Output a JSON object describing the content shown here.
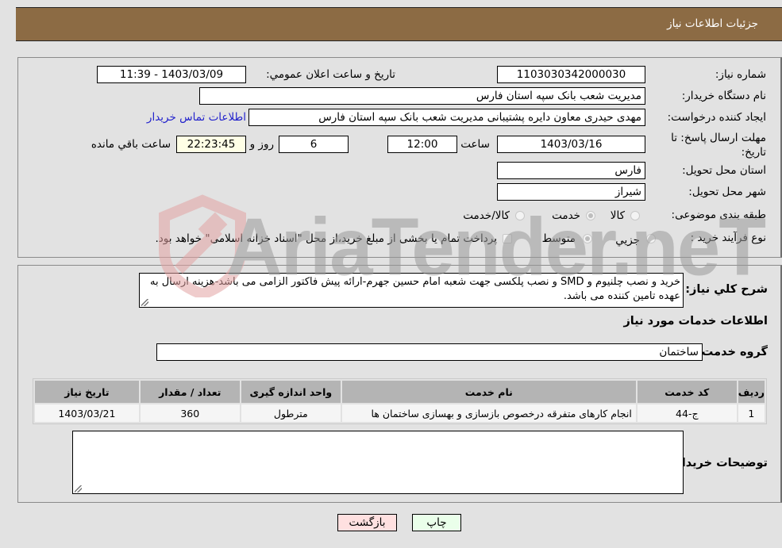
{
  "header": {
    "title": "جزئیات اطلاعات نیاز"
  },
  "details": {
    "need_number_label": "شماره نیاز:",
    "need_number": "1103030342000030",
    "announce_label": "تاریخ و ساعت اعلان عمومي:",
    "announce_value": "1403/03/09 - 11:39",
    "buyer_org_label": "نام دستگاه خریدار:",
    "buyer_org": "مدیریت شعب بانک سپه استان فارس",
    "creator_label": "ایجاد کننده درخواست:",
    "creator": "مهدی حیدری معاون دایره پشتیبانی مدیریت شعب بانک سپه استان فارس",
    "contact_link": "اطلاعات تماس خریدار",
    "deadline_label": "مهلت ارسال پاسخ: تا تاریخ:",
    "deadline_date": "1403/03/16",
    "time_label": "ساعت",
    "deadline_time": "12:00",
    "days_value": "6",
    "days_label": "روز و",
    "remaining_time": "22:23:45",
    "remaining_label": "ساعت باقي مانده",
    "province_label": "استان محل تحویل:",
    "province": "فارس",
    "city_label": "شهر محل تحویل:",
    "city": "شیراز",
    "category_label": "طبقه بندی موضوعی:",
    "category_options": [
      {
        "label": "کالا",
        "checked": false
      },
      {
        "label": "خدمت",
        "checked": true
      },
      {
        "label": "کالا/خدمت",
        "checked": false
      }
    ],
    "process_label": "نوع فرآیند خرید :",
    "process_options": [
      {
        "label": "جزيي",
        "checked": false
      },
      {
        "label": "متوسط",
        "checked": true
      }
    ],
    "treasury_note": "پرداخت تمام یا بخشی از مبلغ خرید،از محل \"اسناد خزانه اسلامی\" خواهد بود."
  },
  "description": {
    "label": "شرح کلي نياز:",
    "text": "خرید و نصب چلنیوم و SMD و نصب پلکسی جهت شعبه امام حسین جهرم-ارائه پیش فاکتور الزامی می باشد-هزینه ارسال به عهده تامین کننده می باشد."
  },
  "services": {
    "section_title": "اطلاعات خدمات مورد نياز",
    "group_label": "گروه خدمت:",
    "group_value": "ساختمان",
    "columns": [
      "رديف",
      "کد خدمت",
      "نام خدمت",
      "واحد اندازه گیری",
      "تعداد / مقدار",
      "تاريخ نياز"
    ],
    "rows": [
      {
        "row": "1",
        "code": "ج-44",
        "name": "انجام کارهای متفرقه درخصوص بازسازی و بهسازی ساختمان ها",
        "unit": "مترطول",
        "qty": "360",
        "date": "1403/03/21"
      }
    ]
  },
  "buyer_notes": {
    "label": "توضيحات خريدار:",
    "value": ""
  },
  "buttons": {
    "print": "چاپ",
    "back": "بازگشت"
  },
  "watermark": {
    "text": "AriaTender.neT"
  }
}
